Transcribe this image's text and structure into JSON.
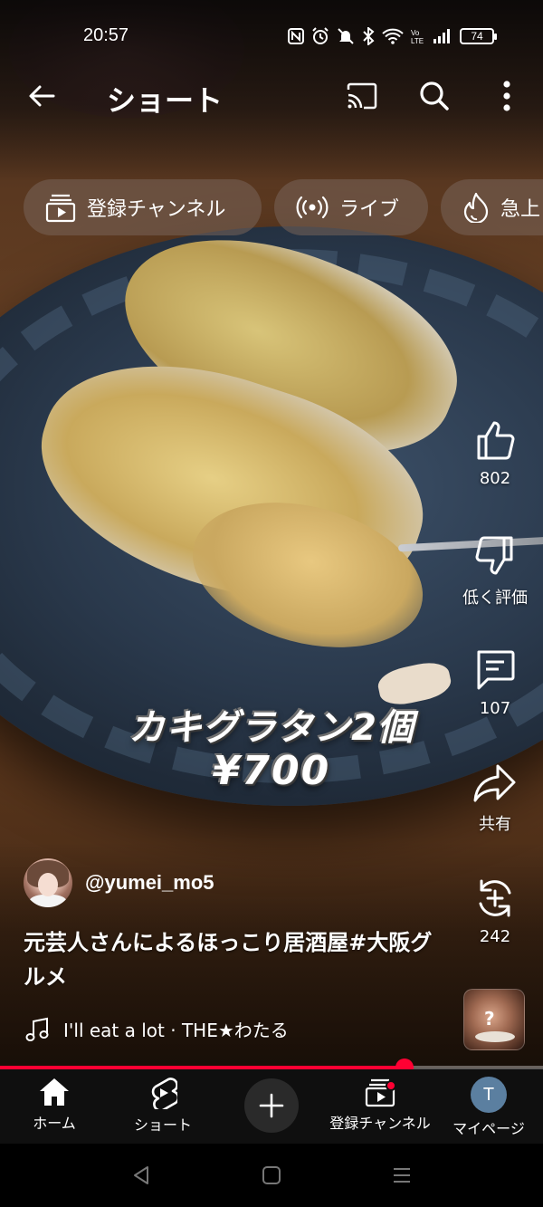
{
  "status_bar": {
    "time": "20:57",
    "battery": "74",
    "icons": [
      "nfc-icon",
      "alarm-icon",
      "mute-icon",
      "bluetooth-icon",
      "wifi-icon",
      "volte-icon",
      "signal-icon"
    ]
  },
  "app_bar": {
    "title": "ショート"
  },
  "chips": [
    {
      "label": "登録チャンネル",
      "icon": "subscriptions-icon"
    },
    {
      "label": "ライブ",
      "icon": "live-icon"
    },
    {
      "label": "急上",
      "icon": "trending-icon"
    }
  ],
  "video": {
    "caption_line1": "カキグラタン2個",
    "caption_line2": "¥700"
  },
  "actions": {
    "like_count": "802",
    "dislike_label": "低く評価",
    "comment_count": "107",
    "share_label": "共有",
    "remix_count": "242"
  },
  "channel": {
    "handle": "@yumei_mo5"
  },
  "description": "元芸人さんによるほっこり居酒屋#大阪グルメ",
  "music": {
    "text": "I'll eat a lot · THE★わたる"
  },
  "progress": {
    "fraction": 0.745
  },
  "bottom_nav": {
    "home": "ホーム",
    "shorts": "ショート",
    "subscriptions": "登録チャンネル",
    "my_page": "マイページ",
    "avatar_letter": "T"
  },
  "colors": {
    "accent": "#ff0033",
    "nav_background": "#0f0f0f",
    "chip_background": "#786459"
  }
}
